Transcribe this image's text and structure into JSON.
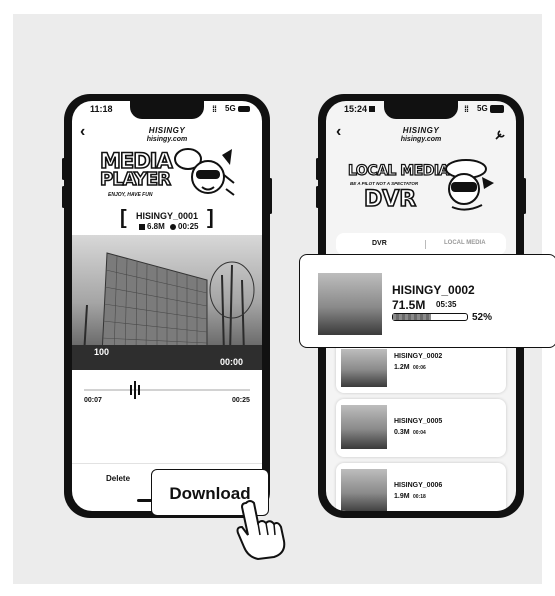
{
  "left_phone": {
    "status_time": "11:18",
    "status_network": "5G",
    "brand_name": "HISINGY",
    "brand_domain": "hisingy.com",
    "hero_title_line1": "MEDIA",
    "hero_title_line2": "PLAYER",
    "hero_tagline": "ENJOY, HAVE FUN",
    "file_name": "HISINGY_0001",
    "file_size": "6.8M",
    "file_duration": "00:25",
    "overlay_left": "100",
    "overlay_right": "00:00",
    "time_current": "00:07",
    "time_total": "00:25",
    "delete_label": "Delete",
    "download_label": "Download"
  },
  "right_phone": {
    "status_time": "15:24",
    "status_network": "5G",
    "brand_name": "HISINGY",
    "brand_domain": "hisingy.com",
    "hero_title_line1": "LOCAL MEDIA",
    "hero_tagline": "BE A PILOT NOT A SPECTATOR",
    "hero_title_line2": "DVR",
    "tab_dvr": "DVR",
    "tab_local": "LOCAL MEDIA",
    "download_card": {
      "name": "HISINGY_0002",
      "size": "71.5M",
      "duration": "05:35",
      "progress_percent": 52,
      "progress_label": "52%"
    },
    "files": [
      {
        "name": "HISINGY_0002",
        "size": "1.2M",
        "duration": "00:06"
      },
      {
        "name": "HISINGY_0005",
        "size": "0.3M",
        "duration": "00:04"
      },
      {
        "name": "HISINGY_0006",
        "size": "1.9M",
        "duration": "00:18"
      }
    ]
  },
  "colors": {
    "stage": "#ececec",
    "phone": "#111111",
    "progress": "#8a8a8a"
  }
}
